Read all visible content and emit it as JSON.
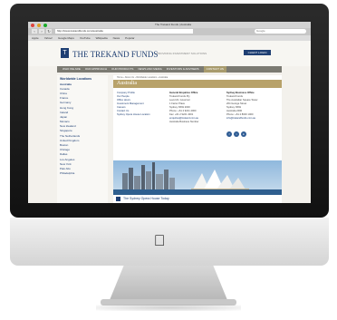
{
  "browser": {
    "window_title": "The Trekand Funds | Australia",
    "url": "http://www.trekandfunds.com/australia",
    "search_placeholder": "Google",
    "bookmarks": [
      "Apple",
      "Yahoo!",
      "Google Maps",
      "YouTube",
      "Wikipedia",
      "News",
      "Popular"
    ]
  },
  "site": {
    "logo_mark": "T",
    "logo_name": "THE TREKAND FUNDS",
    "header_tagline": "PROVIDING INVESTMENT SOLUTIONS",
    "header_button": "CLIENT LOGIN",
    "nav": [
      "WHO WE ARE",
      "OUR APPROACH",
      "OUR PRODUCTS",
      "NEWS AND MEDIA",
      "INVESTORS & ADVISERS",
      "CONTACT US"
    ],
    "nav_active_index": 5
  },
  "sidebar": {
    "heading": "Worldwide Locations",
    "active_item": "Australia",
    "items": [
      "Canada",
      "China",
      "France",
      "Germany",
      "Hong Kong",
      "Ireland",
      "Japan",
      "Monaco",
      "New Zealand",
      "Singapore",
      "The Netherlands",
      "United Kingdom",
      "Boston",
      "Chicago",
      "Dallas",
      "Los Angeles",
      "New York",
      "Palo Alto",
      "Philadelphia"
    ]
  },
  "content": {
    "breadcrumb": "Home › About Us › Worldwide Locations › Australia",
    "title": "Australia",
    "left_links": [
      "Company Profile",
      "Our People",
      "Office Hours",
      "Investment Management",
      "Careers",
      "Contact Us",
      "Sydney Opera House Location"
    ],
    "mid": {
      "heading": "General Enquiries Office",
      "lines": [
        "Trekand Funds Pty",
        "Level 22, Governor",
        "1 Farrer Place",
        "Sydney NSW 2000",
        "Phone: +61 2 9221 4000",
        "Fax: +61 2 9221 4001",
        "enquiries@trekand.com.au",
        "Australia Business Number"
      ]
    },
    "right": {
      "heading": "Sydney Business Office",
      "lines": [
        "Trekand Funds",
        "The Australian Square Tower",
        "264 George Street",
        "Sydney NSW",
        "Australia 2000",
        "Phone: +61 2 8000 1000",
        "info@trekandfunds.com.au"
      ]
    },
    "caption": "The Sydney Opera House Today"
  },
  "colors": {
    "navy": "#1f3f73",
    "gold": "#b8a26a",
    "nav_gray": "#7b7a72",
    "page_bg": "#f3f1ec"
  },
  "icons": [
    "apple-logo-icon",
    "facebook-icon",
    "twitter-icon",
    "linkedin-icon"
  ]
}
